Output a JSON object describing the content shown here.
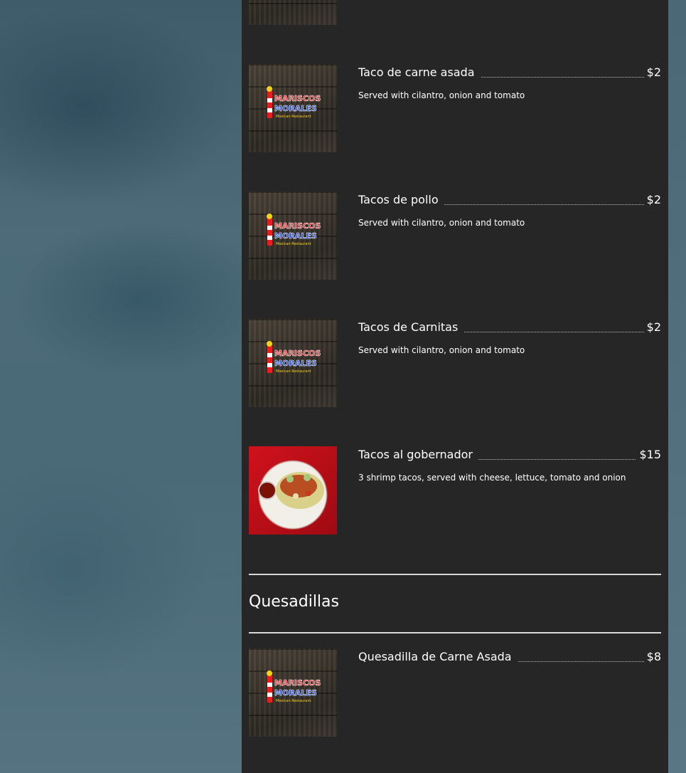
{
  "colors": {
    "panel": "#262626",
    "text": "#ffffff",
    "accent_red": "#d0121c"
  },
  "logo": {
    "line1": "MARISCOS",
    "line2": "MORALES",
    "line3": "Mexican Restaurant"
  },
  "items": [
    {
      "name": "Taco de carne asada",
      "price": "$2",
      "description": "Served with cilantro, onion and tomato",
      "image": "restaurant-logo-image"
    },
    {
      "name": "Tacos de pollo",
      "price": "$2",
      "description": "Served with cilantro, onion and tomato",
      "image": "restaurant-logo-image"
    },
    {
      "name": "Tacos de Carnitas",
      "price": "$2",
      "description": "Served with cilantro, onion and tomato",
      "image": "restaurant-logo-image"
    },
    {
      "name": "Tacos al gobernador",
      "price": "$15",
      "description": "3 shrimp tacos, served with cheese, lettuce, tomato and onion",
      "image": "shrimp-tacos-photo"
    }
  ],
  "sections": [
    {
      "title": "Quesadillas",
      "items": [
        {
          "name": "Quesadilla de Carne Asada",
          "price": "$8",
          "image": "restaurant-logo-image"
        }
      ]
    }
  ]
}
